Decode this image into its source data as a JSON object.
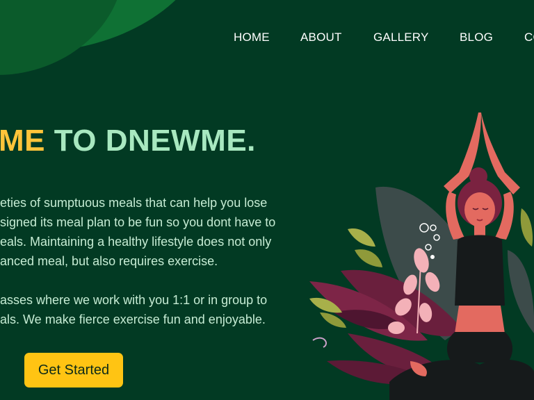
{
  "nav": {
    "items": [
      "HOME",
      "ABOUT",
      "GALLERY",
      "BLOG",
      "CO"
    ]
  },
  "hero": {
    "title_accent": "ME",
    "title_rest": " TO DNEWME.",
    "paragraph1": [
      "eties of sumptuous meals that can help you lose",
      "signed its meal plan to be fun so you dont have to",
      "eals. Maintaining a healthy lifestyle does not only",
      "anced meal, but also requires exercise."
    ],
    "paragraph2": [
      "asses where we work with you 1:1 or in group to",
      "als. We make fierce exercise fun and enjoyable."
    ],
    "cta_label": "Get Started"
  },
  "colors": {
    "background": "#023a23",
    "accent": "#ffc43a",
    "title_green": "#a8e8c0",
    "button": "#ffc413"
  },
  "illustration": {
    "icon": "yoga-woman-meditating-illustration"
  }
}
